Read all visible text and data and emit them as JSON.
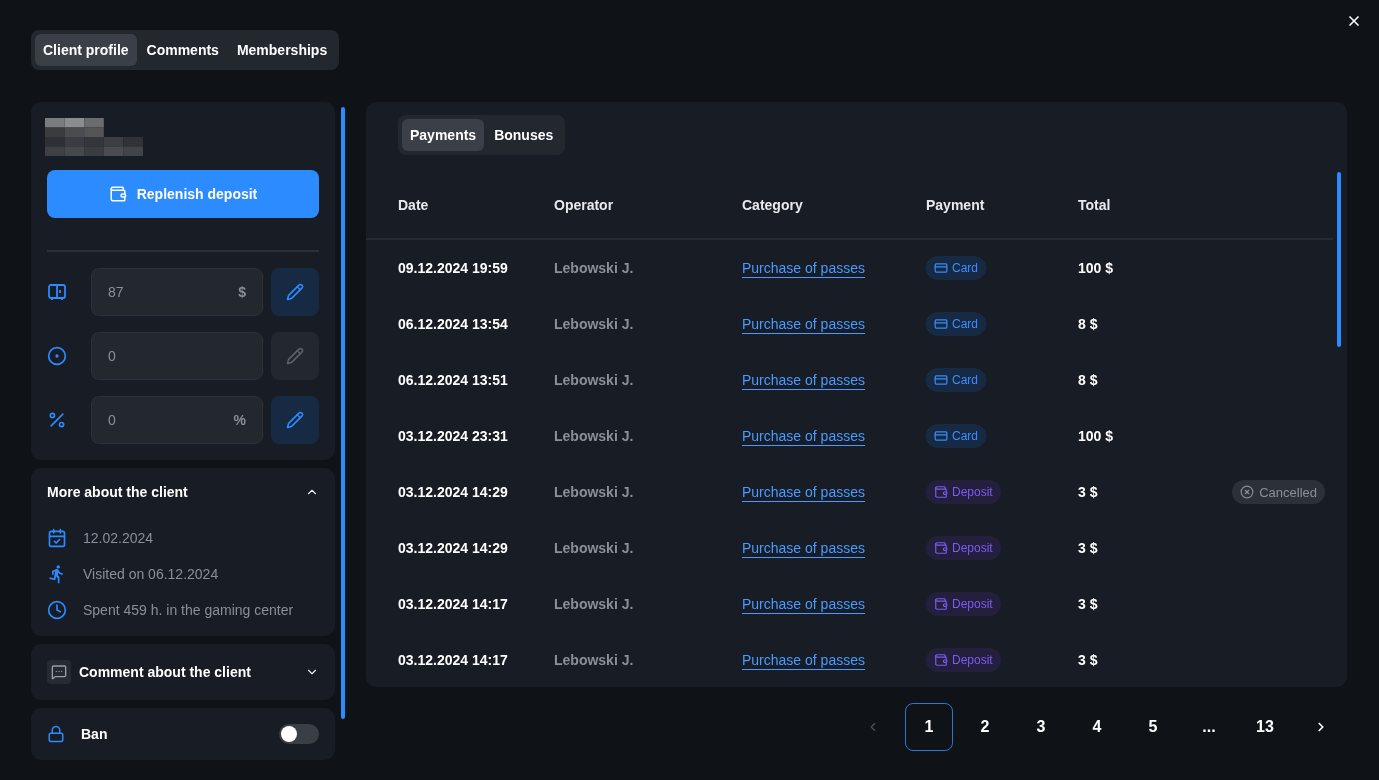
{
  "tabs": [
    {
      "label": "Client profile",
      "selected": true
    },
    {
      "label": "Comments",
      "selected": false
    },
    {
      "label": "Memberships",
      "selected": false
    }
  ],
  "client": {
    "replenish_button": "Replenish deposit",
    "balances": [
      {
        "kind": "deposit",
        "value": "87",
        "unit": "$",
        "editable": true
      },
      {
        "kind": "bonus",
        "value": "0",
        "editable": false
      },
      {
        "kind": "discount",
        "value": "0",
        "unit": "%",
        "editable": true
      }
    ]
  },
  "more_about": {
    "title": "More about the client",
    "expanded": true,
    "items": [
      {
        "kind": "calendar",
        "text": "12.02.2024"
      },
      {
        "kind": "visit",
        "text": "Visited on 06.12.2024"
      },
      {
        "kind": "time",
        "text": "Spent 459 h. in the gaming center"
      }
    ]
  },
  "comment": {
    "title": "Comment about the client",
    "expanded": false
  },
  "ban": {
    "label": "Ban",
    "on": false
  },
  "payment_tabs": [
    {
      "label": "Payments",
      "selected": true
    },
    {
      "label": "Bonuses",
      "selected": false
    }
  ],
  "table": {
    "columns": [
      "Date",
      "Operator",
      "Category",
      "Payment",
      "Total"
    ],
    "rows": [
      {
        "date": "09.12.2024 19:59",
        "operator": "Lebowski J.",
        "category": "Purchase of passes",
        "payment": {
          "kind": "card",
          "label": "Card"
        },
        "total": "100 $"
      },
      {
        "date": "06.12.2024 13:54",
        "operator": "Lebowski J.",
        "category": "Purchase of passes",
        "payment": {
          "kind": "card",
          "label": "Card"
        },
        "total": "8 $"
      },
      {
        "date": "06.12.2024 13:51",
        "operator": "Lebowski J.",
        "category": "Purchase of passes",
        "payment": {
          "kind": "card",
          "label": "Card"
        },
        "total": "8 $"
      },
      {
        "date": "03.12.2024 23:31",
        "operator": "Lebowski J.",
        "category": "Purchase of passes",
        "payment": {
          "kind": "card",
          "label": "Card"
        },
        "total": "100 $"
      },
      {
        "date": "03.12.2024 14:29",
        "operator": "Lebowski J.",
        "category": "Purchase of passes",
        "payment": {
          "kind": "deposit",
          "label": "Deposit"
        },
        "total": "3 $",
        "status": "Cancelled"
      },
      {
        "date": "03.12.2024 14:29",
        "operator": "Lebowski J.",
        "category": "Purchase of passes",
        "payment": {
          "kind": "deposit",
          "label": "Deposit"
        },
        "total": "3 $"
      },
      {
        "date": "03.12.2024 14:17",
        "operator": "Lebowski J.",
        "category": "Purchase of passes",
        "payment": {
          "kind": "deposit",
          "label": "Deposit"
        },
        "total": "3 $"
      },
      {
        "date": "03.12.2024 14:17",
        "operator": "Lebowski J.",
        "category": "Purchase of passes",
        "payment": {
          "kind": "deposit",
          "label": "Deposit"
        },
        "total": "3 $"
      }
    ]
  },
  "pagination": {
    "prev_disabled": true,
    "pages": [
      {
        "label": "1",
        "selected": true
      },
      {
        "label": "2",
        "selected": false
      },
      {
        "label": "3",
        "selected": false
      },
      {
        "label": "4",
        "selected": false
      },
      {
        "label": "5",
        "selected": false
      },
      {
        "label": "...",
        "selected": false
      },
      {
        "label": "13",
        "selected": false
      }
    ]
  }
}
